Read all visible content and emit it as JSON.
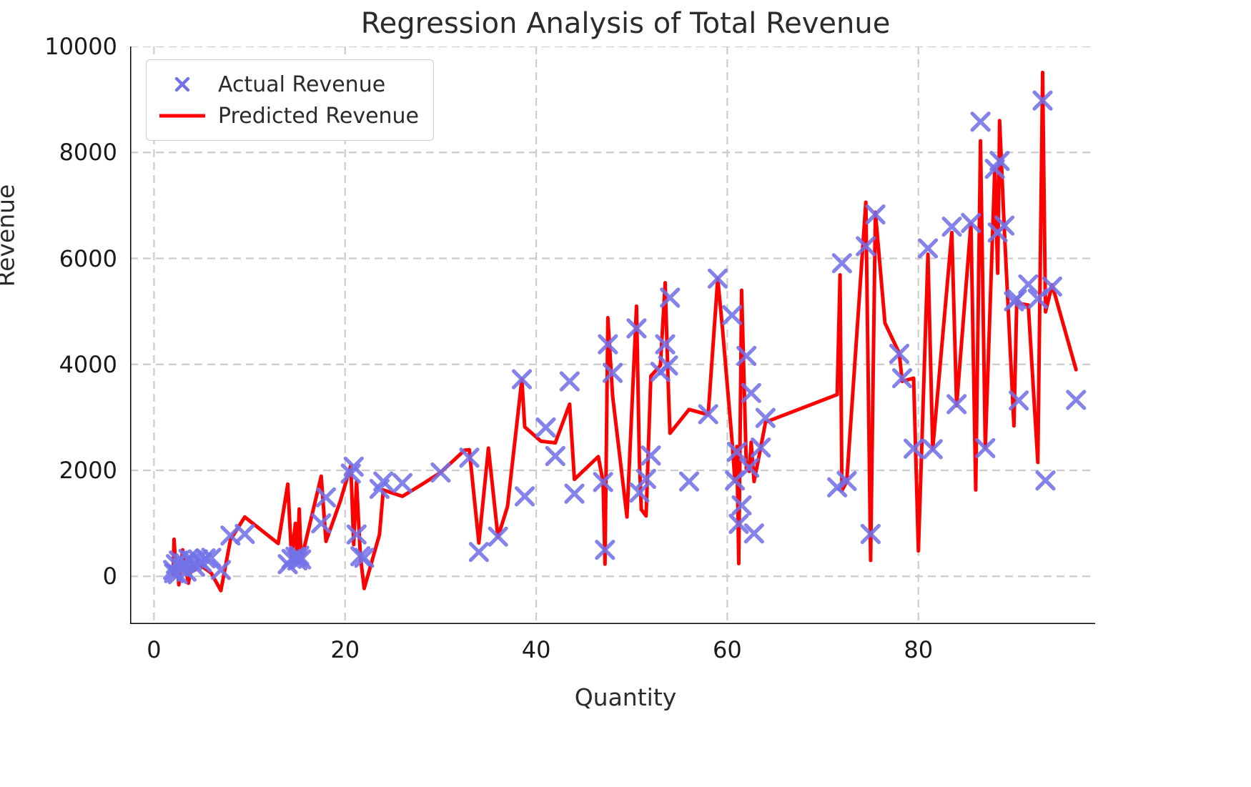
{
  "chart_data": {
    "type": "scatter",
    "title": "Regression Analysis of Total Revenue",
    "xlabel": "Quantity",
    "ylabel": "Revenue",
    "xlim": [
      -2.5,
      98.5
    ],
    "ylim": [
      -900,
      10000
    ],
    "xticks": [
      0,
      20,
      40,
      60,
      80
    ],
    "yticks": [
      0,
      2000,
      4000,
      6000,
      8000,
      10000
    ],
    "xtick_labels": [
      "0",
      "20",
      "40",
      "60",
      "80"
    ],
    "ytick_labels": [
      "0",
      "2000",
      "4000",
      "6000",
      "8000",
      "10000"
    ],
    "grid": true,
    "grid_style": "dashed",
    "grid_color": "#cccccc",
    "legend_position": "upper left",
    "series": [
      {
        "name": "Actual Revenue",
        "type": "scatter",
        "marker": "x",
        "color": "#7272E8",
        "points": [
          [
            2.0,
            120
          ],
          [
            2.1,
            60
          ],
          [
            2.3,
            230
          ],
          [
            2.5,
            40
          ],
          [
            2.6,
            300
          ],
          [
            3.0,
            160
          ],
          [
            3.2,
            250
          ],
          [
            3.4,
            90
          ],
          [
            3.6,
            330
          ],
          [
            4.0,
            300
          ],
          [
            4.3,
            180
          ],
          [
            4.6,
            320
          ],
          [
            5.0,
            260
          ],
          [
            5.4,
            340
          ],
          [
            6.0,
            350
          ],
          [
            7.0,
            120
          ],
          [
            8.0,
            770
          ],
          [
            9.5,
            800
          ],
          [
            14.0,
            230
          ],
          [
            14.4,
            330
          ],
          [
            14.8,
            370
          ],
          [
            15.0,
            300
          ],
          [
            15.2,
            390
          ],
          [
            15.4,
            320
          ],
          [
            17.5,
            1000
          ],
          [
            18.0,
            1490
          ],
          [
            20.6,
            1940
          ],
          [
            20.9,
            2070
          ],
          [
            21.2,
            790
          ],
          [
            21.6,
            380
          ],
          [
            22.0,
            350
          ],
          [
            23.6,
            1650
          ],
          [
            24.0,
            1790
          ],
          [
            26.0,
            1760
          ],
          [
            30.0,
            1960
          ],
          [
            33.0,
            2240
          ],
          [
            34.0,
            460
          ],
          [
            36.0,
            750
          ],
          [
            38.5,
            3720
          ],
          [
            38.8,
            1510
          ],
          [
            41.0,
            2810
          ],
          [
            42.0,
            2270
          ],
          [
            43.5,
            3680
          ],
          [
            44.0,
            1560
          ],
          [
            47.0,
            1780
          ],
          [
            47.2,
            500
          ],
          [
            47.5,
            4380
          ],
          [
            48.0,
            3840
          ],
          [
            50.5,
            4680
          ],
          [
            50.8,
            1580
          ],
          [
            51.5,
            1840
          ],
          [
            52.0,
            2280
          ],
          [
            53.0,
            3860
          ],
          [
            53.5,
            4380
          ],
          [
            53.8,
            3980
          ],
          [
            54.0,
            5260
          ],
          [
            56.0,
            1790
          ],
          [
            58.0,
            3060
          ],
          [
            59.0,
            5620
          ],
          [
            60.5,
            4930
          ],
          [
            60.8,
            1810
          ],
          [
            61.0,
            2350
          ],
          [
            61.2,
            990
          ],
          [
            61.5,
            1340
          ],
          [
            62.0,
            4160
          ],
          [
            62.3,
            2050
          ],
          [
            62.5,
            3460
          ],
          [
            62.8,
            810
          ],
          [
            63.5,
            2430
          ],
          [
            64.0,
            2990
          ],
          [
            71.5,
            1680
          ],
          [
            72.0,
            5910
          ],
          [
            72.5,
            1800
          ],
          [
            74.5,
            6230
          ],
          [
            75.0,
            800
          ],
          [
            75.5,
            6830
          ],
          [
            78.0,
            4200
          ],
          [
            78.3,
            3740
          ],
          [
            79.5,
            2410
          ],
          [
            81.0,
            6190
          ],
          [
            81.5,
            2400
          ],
          [
            83.5,
            6600
          ],
          [
            84.0,
            3250
          ],
          [
            85.5,
            6670
          ],
          [
            86.5,
            8580
          ],
          [
            87.0,
            2420
          ],
          [
            88.0,
            7690
          ],
          [
            88.3,
            6490
          ],
          [
            88.5,
            7840
          ],
          [
            89.0,
            6620
          ],
          [
            90.0,
            5190
          ],
          [
            90.3,
            5230
          ],
          [
            90.5,
            3320
          ],
          [
            91.5,
            5510
          ],
          [
            92.5,
            5240
          ],
          [
            93.0,
            8980
          ],
          [
            93.3,
            1810
          ],
          [
            94.0,
            5470
          ],
          [
            96.5,
            3330
          ]
        ]
      },
      {
        "name": "Predicted Revenue",
        "type": "line",
        "color": "#FF0000",
        "points": [
          [
            2.0,
            40
          ],
          [
            2.1,
            700
          ],
          [
            2.3,
            120
          ],
          [
            2.5,
            60
          ],
          [
            2.6,
            -160
          ],
          [
            3.0,
            500
          ],
          [
            3.2,
            170
          ],
          [
            3.4,
            60
          ],
          [
            3.6,
            -130
          ],
          [
            4.0,
            260
          ],
          [
            4.3,
            120
          ],
          [
            4.6,
            300
          ],
          [
            5.0,
            190
          ],
          [
            5.4,
            140
          ],
          [
            6.0,
            60
          ],
          [
            7.0,
            -270
          ],
          [
            8.0,
            690
          ],
          [
            9.5,
            1120
          ],
          [
            13.0,
            620
          ],
          [
            14.0,
            1740
          ],
          [
            14.4,
            350
          ],
          [
            14.8,
            1000
          ],
          [
            15.0,
            260
          ],
          [
            15.2,
            1270
          ],
          [
            15.4,
            300
          ],
          [
            17.5,
            1890
          ],
          [
            18.0,
            660
          ],
          [
            19.5,
            1420
          ],
          [
            20.6,
            2090
          ],
          [
            20.9,
            600
          ],
          [
            21.2,
            1790
          ],
          [
            21.6,
            380
          ],
          [
            22.0,
            -230
          ],
          [
            23.6,
            790
          ],
          [
            24.0,
            1630
          ],
          [
            26.0,
            1510
          ],
          [
            28.0,
            1730
          ],
          [
            30.0,
            1960
          ],
          [
            32.5,
            2380
          ],
          [
            33.0,
            2390
          ],
          [
            34.0,
            630
          ],
          [
            35.0,
            2420
          ],
          [
            36.0,
            740
          ],
          [
            37.0,
            1320
          ],
          [
            38.5,
            3720
          ],
          [
            38.8,
            2820
          ],
          [
            40.5,
            2550
          ],
          [
            42.0,
            2520
          ],
          [
            43.5,
            3250
          ],
          [
            44.0,
            1830
          ],
          [
            46.5,
            2260
          ],
          [
            47.0,
            1780
          ],
          [
            47.2,
            230
          ],
          [
            47.5,
            4880
          ],
          [
            48.0,
            3400
          ],
          [
            49.5,
            1120
          ],
          [
            50.5,
            5100
          ],
          [
            50.8,
            2180
          ],
          [
            51.0,
            1260
          ],
          [
            51.5,
            1140
          ],
          [
            52.0,
            3780
          ],
          [
            53.0,
            3980
          ],
          [
            53.5,
            5540
          ],
          [
            53.8,
            3720
          ],
          [
            54.0,
            2700
          ],
          [
            56.0,
            3150
          ],
          [
            58.0,
            3050
          ],
          [
            59.0,
            5620
          ],
          [
            59.5,
            4670
          ],
          [
            60.5,
            2550
          ],
          [
            60.8,
            1790
          ],
          [
            61.0,
            2450
          ],
          [
            61.2,
            240
          ],
          [
            61.5,
            5400
          ],
          [
            62.0,
            2030
          ],
          [
            62.3,
            1980
          ],
          [
            62.5,
            2530
          ],
          [
            62.8,
            1790
          ],
          [
            63.5,
            2430
          ],
          [
            64.0,
            2910
          ],
          [
            71.5,
            3430
          ],
          [
            71.8,
            5690
          ],
          [
            72.0,
            1620
          ],
          [
            72.5,
            1790
          ],
          [
            74.5,
            7060
          ],
          [
            75.0,
            300
          ],
          [
            75.5,
            6870
          ],
          [
            76.5,
            4780
          ],
          [
            78.0,
            4210
          ],
          [
            78.3,
            3680
          ],
          [
            79.5,
            3740
          ],
          [
            80.0,
            480
          ],
          [
            81.0,
            6080
          ],
          [
            81.5,
            2400
          ],
          [
            83.5,
            6490
          ],
          [
            84.0,
            3220
          ],
          [
            85.5,
            6660
          ],
          [
            86.0,
            1630
          ],
          [
            86.5,
            8220
          ],
          [
            87.0,
            2420
          ],
          [
            88.0,
            7710
          ],
          [
            88.3,
            5720
          ],
          [
            88.5,
            8600
          ],
          [
            89.0,
            6520
          ],
          [
            90.0,
            2840
          ],
          [
            90.3,
            5240
          ],
          [
            90.5,
            5150
          ],
          [
            91.5,
            5120
          ],
          [
            92.5,
            2150
          ],
          [
            93.0,
            9510
          ],
          [
            93.3,
            4990
          ],
          [
            94.0,
            5500
          ],
          [
            96.5,
            3900
          ]
        ]
      }
    ]
  },
  "legend": {
    "items": [
      {
        "label": "Actual Revenue",
        "marker": "x-marker",
        "color": "#7272E8"
      },
      {
        "label": "Predicted Revenue",
        "marker": "line-swatch",
        "color": "#FF0000"
      }
    ]
  }
}
